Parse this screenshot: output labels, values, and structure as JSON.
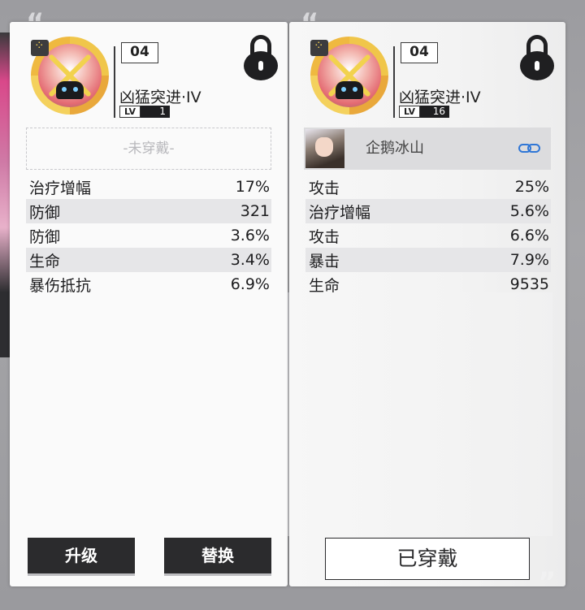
{
  "left_card": {
    "slot": "04",
    "name": "凶猛突进·IV",
    "lv_tag": "LV",
    "level": "1",
    "unworn_text": "-未穿戴-",
    "stats": [
      {
        "label": "治疗增幅",
        "value": "17%"
      },
      {
        "label": "防御",
        "value": "321"
      },
      {
        "label": "防御",
        "value": "3.6%"
      },
      {
        "label": "生命",
        "value": "3.4%"
      },
      {
        "label": "暴伤抵抗",
        "value": "6.9%"
      }
    ],
    "upgrade_label": "升级",
    "replace_label": "替换"
  },
  "right_card": {
    "slot": "04",
    "name": "凶猛突进·IV",
    "lv_tag": "LV",
    "level": "16",
    "wearer_name": "企鹅冰山",
    "stats": [
      {
        "label": "攻击",
        "value": "25%"
      },
      {
        "label": "治疗增幅",
        "value": "5.6%"
      },
      {
        "label": "攻击",
        "value": "6.6%"
      },
      {
        "label": "暴击",
        "value": "7.9%"
      },
      {
        "label": "生命",
        "value": "9535"
      }
    ],
    "worn_label": "已穿戴"
  },
  "colors": {
    "card_bg": "#fafafa",
    "button_dark": "#2b2b2d",
    "link_blue": "#2f76d6",
    "avatar_gold": "#f0c64a"
  },
  "icons": [
    "lock-icon",
    "link-icon",
    "equipment-avatar-icon",
    "character-portrait"
  ]
}
